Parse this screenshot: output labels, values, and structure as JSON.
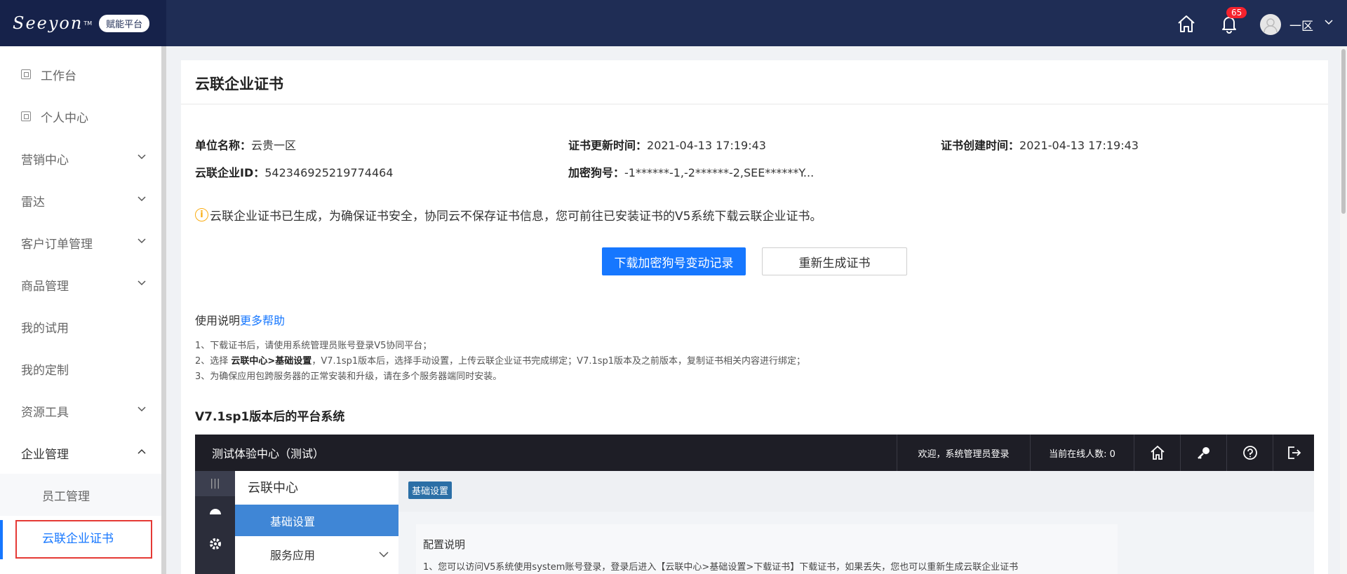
{
  "header": {
    "logo_text": "Seeyon",
    "logo_tm": "TM",
    "logo_badge": "赋能平台",
    "icons": [
      "home-icon",
      "bell-icon",
      "avatar-icon",
      "chevron-down-icon"
    ],
    "notification_count": "65",
    "user_name": "一区"
  },
  "sidebar": {
    "items": [
      {
        "label": "工作台",
        "icon": "page-icon"
      },
      {
        "label": "个人中心",
        "icon": "page-icon"
      },
      {
        "label": "营销中心",
        "caret": "chevron-down-icon"
      },
      {
        "label": "雷达",
        "caret": "chevron-down-icon"
      },
      {
        "label": "客户订单管理",
        "caret": "chevron-down-icon"
      },
      {
        "label": "商品管理",
        "caret": "chevron-down-icon"
      },
      {
        "label": "我的试用"
      },
      {
        "label": "我的定制"
      },
      {
        "label": "资源工具",
        "caret": "chevron-down-icon"
      },
      {
        "label": "企业管理",
        "caret": "chevron-up-icon"
      },
      {
        "label": "员工管理"
      },
      {
        "label": "云联企业证书"
      }
    ],
    "active_color": "#1677ff"
  },
  "main": {
    "title": "云联企业证书",
    "info": {
      "unit_label": "单位名称：",
      "unit_value": "云贵一区",
      "enterprise_id_label": "云联企业ID：",
      "enterprise_id_value": "542346925219774464",
      "update_time_label": "证书更新时间：",
      "update_time_value": "2021-04-13 17:19:43",
      "dongle_label": "加密狗号：",
      "dongle_value": "-1******-1,-2******-2,SEE******Y...",
      "create_time_label": "证书创建时间：",
      "create_time_value": "2021-04-13 17:19:43"
    },
    "notice_icon": "info-icon",
    "notice": "云联企业证书已生成，为确保证书安全，协同云不保存证书信息，您可前往已安装证书的V5系统下载云联企业证书。",
    "buttons": {
      "download_log": "下载加密狗号变动记录",
      "regenerate": "重新生成证书"
    },
    "usage_label": "使用说明",
    "more_help": "更多帮助",
    "steps": {
      "step1": "1、下载证书后，请使用系统管理员账号登录V5协同平台；",
      "step2_prefix": "2、选择 ",
      "step2_bold": "云联中心>基础设置",
      "step2_suffix": "，V7.1sp1版本后，选择手动设置，上传云联企业证书完成绑定；V7.1sp1版本及之前版本，复制证书相关内容进行绑定；",
      "step3": "3、为确保应用包跨服务器的正常安装和升级，请在多个服务器端同时安装。"
    },
    "section_title": "V7.1sp1版本后的平台系统",
    "colors": {
      "primary": "#1677ff",
      "header_bg": "#1f2d55",
      "warning": "#faad14"
    }
  },
  "screenshot": {
    "title": "测试体验中心（测试）",
    "welcome": "欢迎，系统管理员登录",
    "online": "当前在线人数: 0",
    "toolbar_icons": [
      "home-icon",
      "key-icon",
      "help-icon",
      "logout-icon"
    ],
    "nav_icons": [
      "menu-icon",
      "dashboard-icon",
      "gear-icon"
    ],
    "menu_title": "云联中心",
    "menu_active": "基础设置",
    "menu_item": "服务应用",
    "tag": "基础设置",
    "box_title": "配置说明",
    "box_text": "1、您可以访问V5系统使用system账号登录，登录后进入【云联中心>基础设置>下载证书】下载证书，如果丢失，您也可以重新生成云联企业证书"
  }
}
